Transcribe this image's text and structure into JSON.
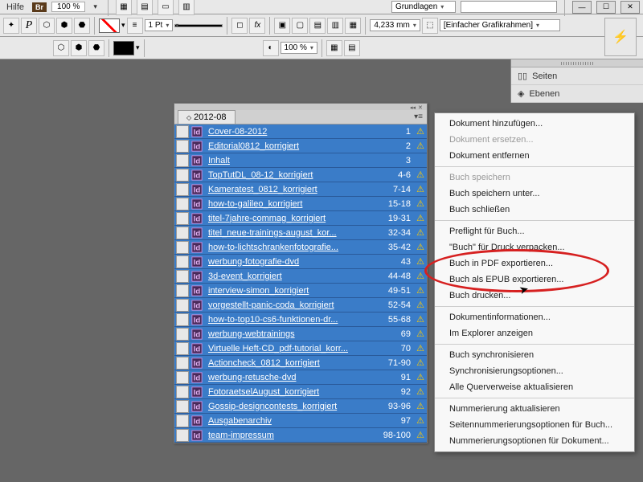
{
  "topbar": {
    "help": "Hilfe",
    "bridge": "Br",
    "zoom": "100 %",
    "basics": "Grundlagen"
  },
  "toolbar": {
    "stroke_weight": "1 Pt",
    "dim_value": "4,233 mm",
    "frame_type": "[Einfacher Grafikrahmen]",
    "scale": "100 %"
  },
  "right_panel": {
    "pages": "Seiten",
    "layers": "Ebenen"
  },
  "book": {
    "tab": "2012-08",
    "rows": [
      {
        "name": "Cover-08-2012",
        "pages": "1",
        "warn": true
      },
      {
        "name": "Editorial0812_korrigiert",
        "pages": "2",
        "warn": true
      },
      {
        "name": "Inhalt",
        "pages": "3",
        "warn": false
      },
      {
        "name": "TopTutDL_08-12_korrigiert",
        "pages": "4-6",
        "warn": true
      },
      {
        "name": "Kameratest_0812_korrigiert",
        "pages": "7-14",
        "warn": true
      },
      {
        "name": "how-to-galileo_korrigiert",
        "pages": "15-18",
        "warn": true
      },
      {
        "name": "titel-7jahre-commag_korrigiert",
        "pages": "19-31",
        "warn": true
      },
      {
        "name": "titel_neue-trainings-august_kor...",
        "pages": "32-34",
        "warn": true
      },
      {
        "name": "how-to-lichtschrankenfotografie...",
        "pages": "35-42",
        "warn": true
      },
      {
        "name": "werbung-fotografie-dvd",
        "pages": "43",
        "warn": true
      },
      {
        "name": "3d-event_korrigiert",
        "pages": "44-48",
        "warn": true
      },
      {
        "name": "interview-simon_korrigiert",
        "pages": "49-51",
        "warn": true
      },
      {
        "name": "vorgestellt-panic-coda_korrigiert",
        "pages": "52-54",
        "warn": true
      },
      {
        "name": "how-to-top10-cs6-funktionen-dr...",
        "pages": "55-68",
        "warn": true
      },
      {
        "name": "werbung-webtrainings",
        "pages": "69",
        "warn": true
      },
      {
        "name": "Virtuelle Heft-CD_pdf-tutorial_korr...",
        "pages": "70",
        "warn": true
      },
      {
        "name": "Actioncheck_0812_korrigiert",
        "pages": "71-90",
        "warn": true
      },
      {
        "name": "werbung-retusche-dvd",
        "pages": "91",
        "warn": true
      },
      {
        "name": "FotoraetselAugust_korrigiert",
        "pages": "92",
        "warn": true
      },
      {
        "name": "Gossip-designcontests_korrigiert",
        "pages": "93-96",
        "warn": true
      },
      {
        "name": "Ausgabenarchiv",
        "pages": "97",
        "warn": true
      },
      {
        "name": "team-impressum",
        "pages": "98-100",
        "warn": true
      }
    ]
  },
  "menu": {
    "add_doc": "Dokument hinzufügen...",
    "replace_doc": "Dokument ersetzen...",
    "remove_doc": "Dokument entfernen",
    "save_book": "Buch speichern",
    "save_book_as": "Buch speichern unter...",
    "close_book": "Buch schließen",
    "preflight": "Preflight für Buch...",
    "package": "\"Buch\" für Druck verpacken...",
    "export_pdf": "Buch in PDF exportieren...",
    "export_epub": "Buch als EPUB exportieren...",
    "print_book": "Buch drucken...",
    "doc_info": "Dokumentinformationen...",
    "show_explorer": "Im Explorer anzeigen",
    "sync_book": "Buch synchronisieren",
    "sync_options": "Synchronisierungsoptionen...",
    "update_xrefs": "Alle Querverweise aktualisieren",
    "update_numbering": "Nummerierung aktualisieren",
    "page_num_options": "Seitennummerierungsoptionen für Buch...",
    "doc_num_options": "Nummerierungsoptionen für Dokument..."
  }
}
